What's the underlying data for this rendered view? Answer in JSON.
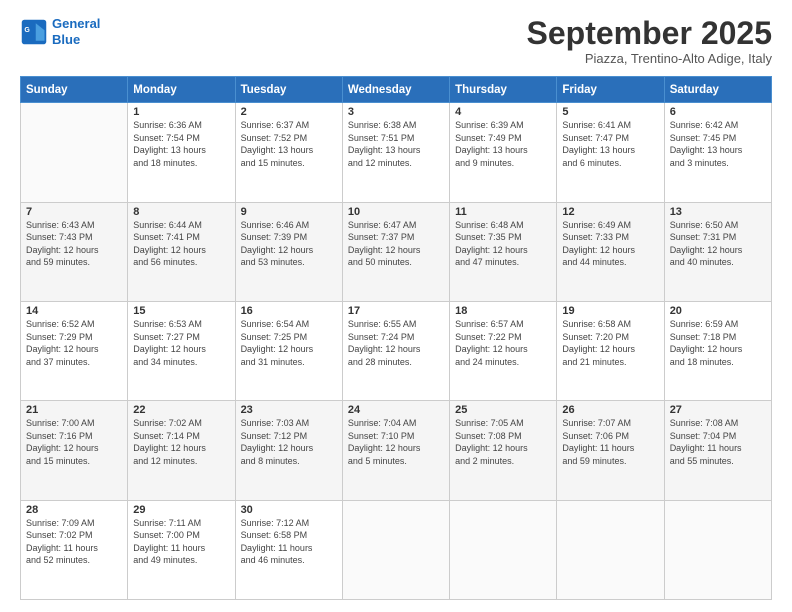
{
  "logo": {
    "line1": "General",
    "line2": "Blue"
  },
  "header": {
    "month": "September 2025",
    "location": "Piazza, Trentino-Alto Adige, Italy"
  },
  "weekdays": [
    "Sunday",
    "Monday",
    "Tuesday",
    "Wednesday",
    "Thursday",
    "Friday",
    "Saturday"
  ],
  "weeks": [
    [
      {
        "day": "",
        "text": ""
      },
      {
        "day": "1",
        "text": "Sunrise: 6:36 AM\nSunset: 7:54 PM\nDaylight: 13 hours\nand 18 minutes."
      },
      {
        "day": "2",
        "text": "Sunrise: 6:37 AM\nSunset: 7:52 PM\nDaylight: 13 hours\nand 15 minutes."
      },
      {
        "day": "3",
        "text": "Sunrise: 6:38 AM\nSunset: 7:51 PM\nDaylight: 13 hours\nand 12 minutes."
      },
      {
        "day": "4",
        "text": "Sunrise: 6:39 AM\nSunset: 7:49 PM\nDaylight: 13 hours\nand 9 minutes."
      },
      {
        "day": "5",
        "text": "Sunrise: 6:41 AM\nSunset: 7:47 PM\nDaylight: 13 hours\nand 6 minutes."
      },
      {
        "day": "6",
        "text": "Sunrise: 6:42 AM\nSunset: 7:45 PM\nDaylight: 13 hours\nand 3 minutes."
      }
    ],
    [
      {
        "day": "7",
        "text": "Sunrise: 6:43 AM\nSunset: 7:43 PM\nDaylight: 12 hours\nand 59 minutes."
      },
      {
        "day": "8",
        "text": "Sunrise: 6:44 AM\nSunset: 7:41 PM\nDaylight: 12 hours\nand 56 minutes."
      },
      {
        "day": "9",
        "text": "Sunrise: 6:46 AM\nSunset: 7:39 PM\nDaylight: 12 hours\nand 53 minutes."
      },
      {
        "day": "10",
        "text": "Sunrise: 6:47 AM\nSunset: 7:37 PM\nDaylight: 12 hours\nand 50 minutes."
      },
      {
        "day": "11",
        "text": "Sunrise: 6:48 AM\nSunset: 7:35 PM\nDaylight: 12 hours\nand 47 minutes."
      },
      {
        "day": "12",
        "text": "Sunrise: 6:49 AM\nSunset: 7:33 PM\nDaylight: 12 hours\nand 44 minutes."
      },
      {
        "day": "13",
        "text": "Sunrise: 6:50 AM\nSunset: 7:31 PM\nDaylight: 12 hours\nand 40 minutes."
      }
    ],
    [
      {
        "day": "14",
        "text": "Sunrise: 6:52 AM\nSunset: 7:29 PM\nDaylight: 12 hours\nand 37 minutes."
      },
      {
        "day": "15",
        "text": "Sunrise: 6:53 AM\nSunset: 7:27 PM\nDaylight: 12 hours\nand 34 minutes."
      },
      {
        "day": "16",
        "text": "Sunrise: 6:54 AM\nSunset: 7:25 PM\nDaylight: 12 hours\nand 31 minutes."
      },
      {
        "day": "17",
        "text": "Sunrise: 6:55 AM\nSunset: 7:24 PM\nDaylight: 12 hours\nand 28 minutes."
      },
      {
        "day": "18",
        "text": "Sunrise: 6:57 AM\nSunset: 7:22 PM\nDaylight: 12 hours\nand 24 minutes."
      },
      {
        "day": "19",
        "text": "Sunrise: 6:58 AM\nSunset: 7:20 PM\nDaylight: 12 hours\nand 21 minutes."
      },
      {
        "day": "20",
        "text": "Sunrise: 6:59 AM\nSunset: 7:18 PM\nDaylight: 12 hours\nand 18 minutes."
      }
    ],
    [
      {
        "day": "21",
        "text": "Sunrise: 7:00 AM\nSunset: 7:16 PM\nDaylight: 12 hours\nand 15 minutes."
      },
      {
        "day": "22",
        "text": "Sunrise: 7:02 AM\nSunset: 7:14 PM\nDaylight: 12 hours\nand 12 minutes."
      },
      {
        "day": "23",
        "text": "Sunrise: 7:03 AM\nSunset: 7:12 PM\nDaylight: 12 hours\nand 8 minutes."
      },
      {
        "day": "24",
        "text": "Sunrise: 7:04 AM\nSunset: 7:10 PM\nDaylight: 12 hours\nand 5 minutes."
      },
      {
        "day": "25",
        "text": "Sunrise: 7:05 AM\nSunset: 7:08 PM\nDaylight: 12 hours\nand 2 minutes."
      },
      {
        "day": "26",
        "text": "Sunrise: 7:07 AM\nSunset: 7:06 PM\nDaylight: 11 hours\nand 59 minutes."
      },
      {
        "day": "27",
        "text": "Sunrise: 7:08 AM\nSunset: 7:04 PM\nDaylight: 11 hours\nand 55 minutes."
      }
    ],
    [
      {
        "day": "28",
        "text": "Sunrise: 7:09 AM\nSunset: 7:02 PM\nDaylight: 11 hours\nand 52 minutes."
      },
      {
        "day": "29",
        "text": "Sunrise: 7:11 AM\nSunset: 7:00 PM\nDaylight: 11 hours\nand 49 minutes."
      },
      {
        "day": "30",
        "text": "Sunrise: 7:12 AM\nSunset: 6:58 PM\nDaylight: 11 hours\nand 46 minutes."
      },
      {
        "day": "",
        "text": ""
      },
      {
        "day": "",
        "text": ""
      },
      {
        "day": "",
        "text": ""
      },
      {
        "day": "",
        "text": ""
      }
    ]
  ]
}
